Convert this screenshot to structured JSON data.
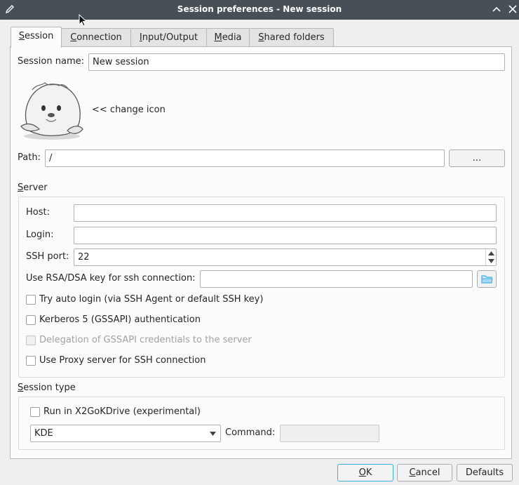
{
  "window": {
    "title": "Session preferences - New session"
  },
  "tabs": [
    {
      "label": "Session",
      "mnemonic": "S",
      "rest": "ession"
    },
    {
      "label": "Connection",
      "mnemonic": "C",
      "rest": "onnection"
    },
    {
      "label": "Input/Output",
      "mnemonic": "I",
      "rest": "nput/Output"
    },
    {
      "label": "Media",
      "mnemonic": "M",
      "rest": "edia"
    },
    {
      "label": "Shared folders",
      "mnemonic": "S",
      "rest": "hared folders"
    }
  ],
  "session": {
    "name_label": "Session name:",
    "name_value": "New session",
    "change_icon_label": "<< change icon",
    "path_label": "Path:",
    "path_value": "/",
    "browse_label": "..."
  },
  "server": {
    "group_mnemonic": "S",
    "group_rest": "erver",
    "host_label": "Host:",
    "host_value": "",
    "login_label": "Login:",
    "login_value": "",
    "ssh_port_label": "SSH port:",
    "ssh_port_value": "22",
    "rsa_label": "Use RSA/DSA key for ssh connection:",
    "rsa_value": "",
    "auto_login_label": "Try auto login (via SSH Agent or default SSH key)",
    "kerberos_label": "Kerberos 5 (GSSAPI) authentication",
    "delegation_label": "Delegation of GSSAPI credentials to the server",
    "proxy_label": "Use Proxy server for SSH connection"
  },
  "session_type": {
    "group_mnemonic": "S",
    "group_rest": "ession type",
    "kdrive_label": "Run in X2GoKDrive (experimental)",
    "type_value": "KDE",
    "command_label": "Command:",
    "command_value": ""
  },
  "buttons": {
    "ok_mnemonic": "O",
    "ok_rest": "K",
    "cancel_mnemonic": "C",
    "cancel_rest": "ancel",
    "defaults_label": "Defaults"
  },
  "colors": {
    "titlebar": "#475057",
    "accent": "#3daee9"
  }
}
